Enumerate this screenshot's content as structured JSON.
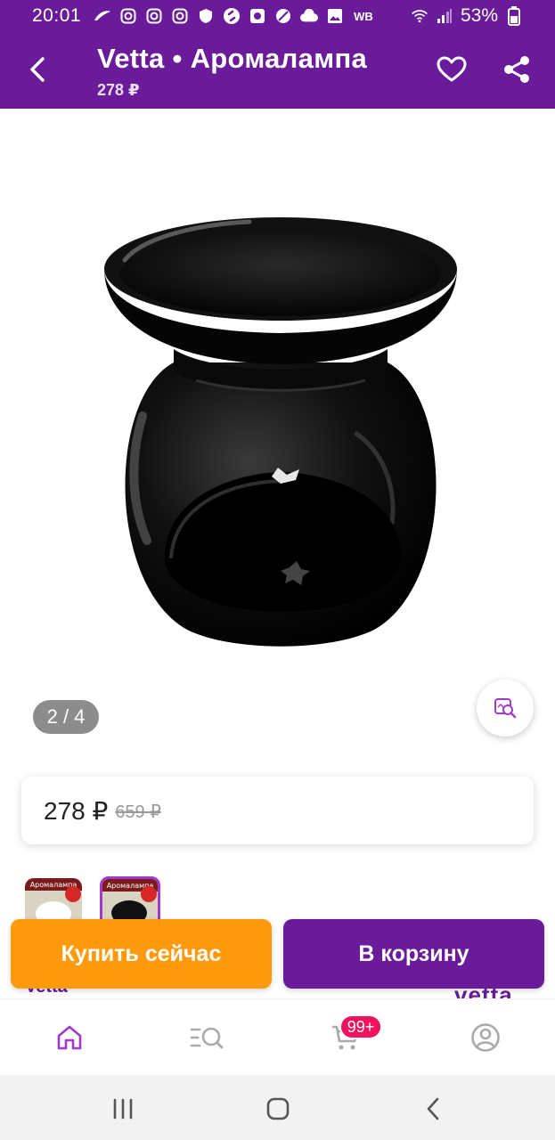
{
  "status_bar": {
    "time": "20:01",
    "wb_label": "WB",
    "battery": "53%",
    "icons": [
      "swoosh-icon",
      "instagram-icon",
      "instagram-icon",
      "instagram-icon",
      "vpn-shield-icon",
      "shazam-icon",
      "camera-app-icon",
      "no-disturb-icon",
      "cloud-icon",
      "image-icon"
    ]
  },
  "header": {
    "title": "Vetta • Аромалампа",
    "subtitle": "278 ₽"
  },
  "gallery": {
    "page_indicator": "2 / 4"
  },
  "price": {
    "current": "278 ₽",
    "old": "659 ₽"
  },
  "thumbnails": {
    "thumb1_text": "Аромалампа",
    "thumb2_text": "Аромалампа"
  },
  "peek": {
    "left": "Vetta",
    "right": "vetta"
  },
  "actions": {
    "buy_now": "Купить сейчас",
    "add_to_cart": "В корзину"
  },
  "bottom_nav": {
    "cart_badge": "99+",
    "active_color": "#a239ca"
  },
  "colors": {
    "brand": "#6a1b9a",
    "buy_now": "#ff9a0f",
    "badge": "#f0125a"
  }
}
